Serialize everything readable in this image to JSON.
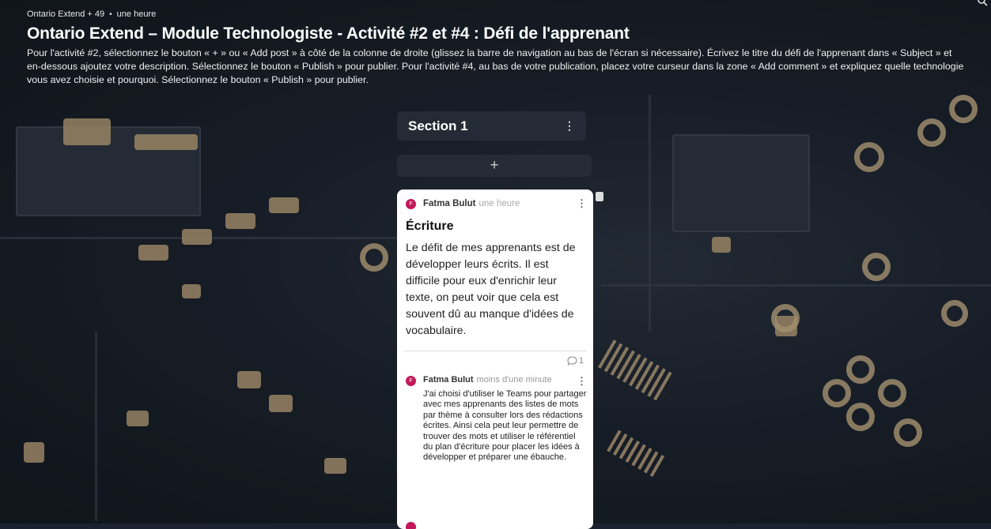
{
  "breadcrumb": {
    "owner": "Ontario Extend + 49",
    "separator": "•",
    "time": "une heure"
  },
  "header": {
    "title": "Ontario Extend – Module Technologiste - Activité #2 et #4 : Défi de l'apprenant",
    "description": "Pour l'activité #2, sélectionnez le bouton « + » ou « Add post » à côté de la colonne de droite (glissez la barre de navigation au bas de l'écran si nécessaire). Écrivez le titre du défi de l'apprenant dans « Subject » et en-dessous ajoutez votre description. Sélectionnez le bouton « Publish » pour publier. Pour l'activité #4, au bas de votre publication, placez votre curseur dans la zone « Add comment » et expliquez quelle technologie vous avez choisie et pourquoi. Sélectionnez le bouton « Publish » pour publier."
  },
  "section": {
    "title": "Section 1",
    "menu": "⋮",
    "add": "+"
  },
  "post": {
    "avatar_letter": "F",
    "author": "Fatma Bulut",
    "time": "une heure",
    "menu": "⋮",
    "title": "Écriture",
    "body": "Le défit de mes apprenants est de développer leurs écrits. Il est difficile pour eux d'enrichir leur texte, on peut voir que cela est souvent dû au manque d'idées de vocabulaire.",
    "comment_count": "1"
  },
  "comment": {
    "avatar_letter": "F",
    "author": "Fatma Bulut",
    "time": "moins d'une minute",
    "menu": "⋮",
    "text": "J'ai choisi d'utiliser le Teams pour partager avec mes apprenants des listes de mots par thème à consulter lors des rédactions écrites. Ainsi cela peut leur permettre de trouver des mots et utiliser le référentiel du plan d'écriture pour placer les idées à développer et préparer une ébauche."
  },
  "colors": {
    "avatar": "#c2185b",
    "card": "#ffffff",
    "section_bg": "#282e38"
  }
}
